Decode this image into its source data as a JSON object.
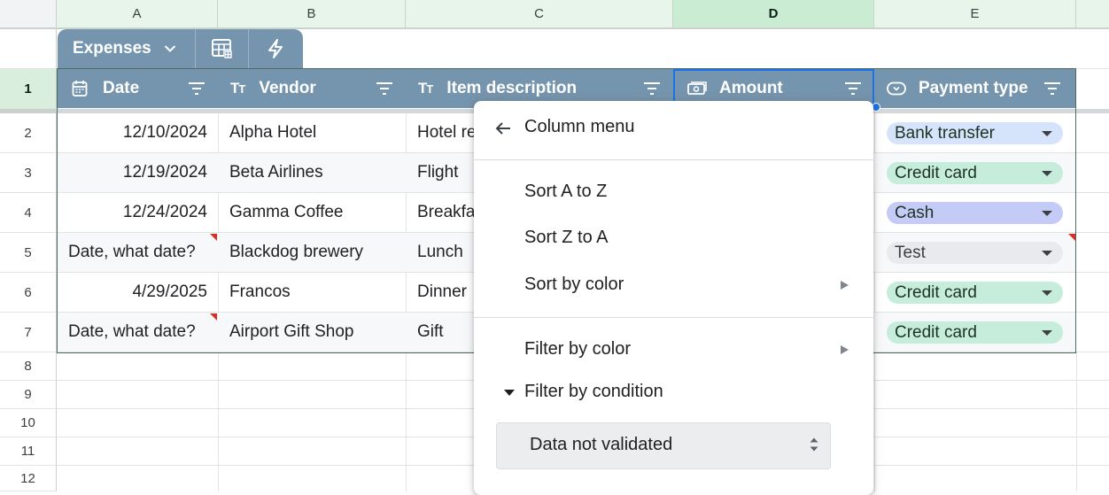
{
  "columns": [
    "A",
    "B",
    "C",
    "D",
    "E"
  ],
  "rows": [
    "1",
    "2",
    "3",
    "4",
    "5",
    "6",
    "7",
    "8",
    "9",
    "10",
    "11",
    "12"
  ],
  "table": {
    "name": "Expenses",
    "headers": [
      "Date",
      "Vendor",
      "Item description",
      "Amount",
      "Payment type"
    ],
    "data": [
      {
        "date": "12/10/2024",
        "vendor": "Alpha Hotel",
        "item": "Hotel re",
        "payment": "Bank transfer"
      },
      {
        "date": "12/19/2024",
        "vendor": "Beta Airlines",
        "item": "Flight",
        "payment": "Credit card"
      },
      {
        "date": "12/24/2024",
        "vendor": "Gamma Coffee",
        "item": "Breakfa",
        "payment": "Cash"
      },
      {
        "date": "Date, what date?",
        "vendor": "Blackdog brewery",
        "item": "Lunch",
        "payment": "Test"
      },
      {
        "date": "4/29/2025",
        "vendor": "Francos",
        "item": "Dinner",
        "payment": "Credit card"
      },
      {
        "date": "Date, what date?",
        "vendor": "Airport Gift Shop",
        "item": "Gift",
        "payment": "Credit card"
      }
    ]
  },
  "menu": {
    "title": "Column menu",
    "sort_az": "Sort A to Z",
    "sort_za": "Sort Z to A",
    "sort_color": "Sort by color",
    "filter_color": "Filter by color",
    "filter_condition": "Filter by condition",
    "condition_value": "Data not validated"
  },
  "colors": {
    "header": "#7594ad",
    "bank_transfer": "#d6e4fb",
    "credit_card": "#c6ecdc",
    "cash": "#c3cbf6",
    "test": "#e8eaed",
    "selection": "#1a73e8"
  }
}
